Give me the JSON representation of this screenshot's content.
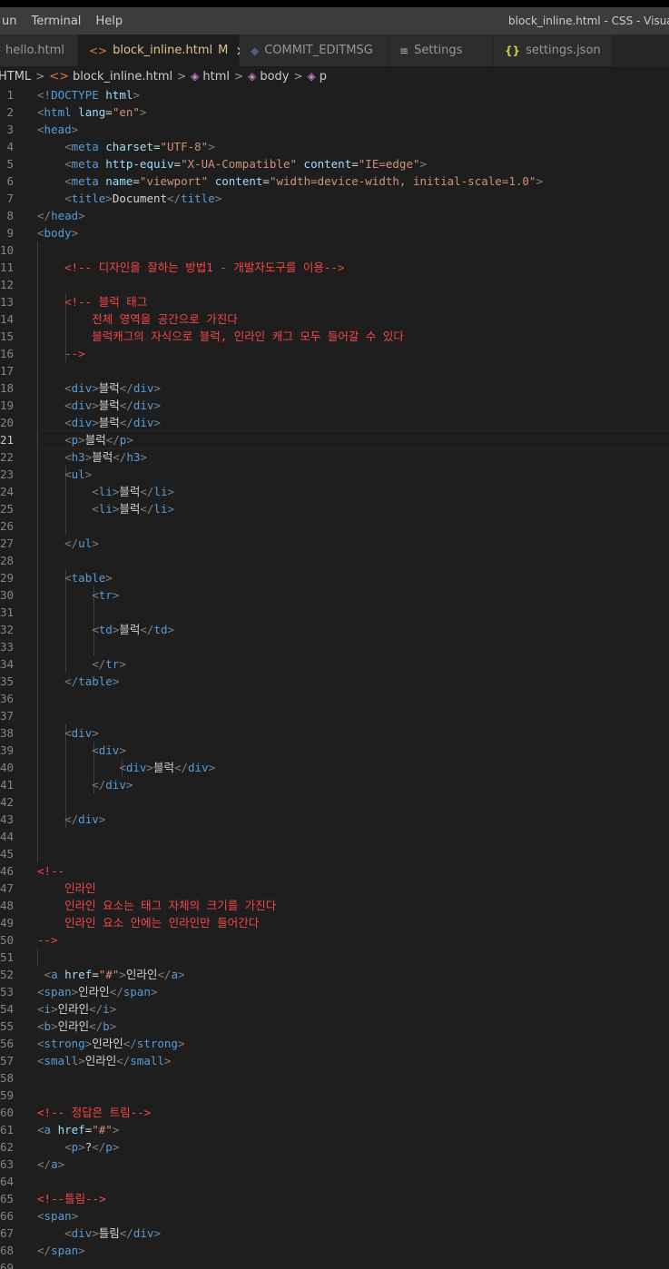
{
  "window": {
    "menu": [
      "un",
      "Terminal",
      "Help"
    ],
    "title": "block_inline.html - CSS - Visual"
  },
  "tabs": [
    {
      "label": "hello.html",
      "icon": "",
      "active": false
    },
    {
      "label": "block_inline.html",
      "icon": "html-file-icon",
      "active": true,
      "modified": "M",
      "close": "×"
    },
    {
      "label": "COMMIT_EDITMSG",
      "icon": "git-file-icon",
      "active": false
    },
    {
      "label": "Settings",
      "icon": "settings-icon",
      "active": false
    },
    {
      "label": "settings.json",
      "icon": "json-file-icon",
      "active": false
    }
  ],
  "breadcrumb": [
    "HTML",
    "block_inline.html",
    "html",
    "body",
    "p"
  ],
  "editor": {
    "current_line": 21,
    "lines": [
      [
        [
          "br",
          "<!"
        ],
        [
          "tag",
          "DOCTYPE "
        ],
        [
          "attr",
          "html"
        ],
        [
          "br",
          ">"
        ]
      ],
      [
        [
          "br",
          "<"
        ],
        [
          "tag",
          "html "
        ],
        [
          "attr",
          "lang"
        ],
        [
          "txt",
          "="
        ],
        [
          "str",
          "\"en\""
        ],
        [
          "br",
          ">"
        ]
      ],
      [
        [
          "br",
          "<"
        ],
        [
          "tag",
          "head"
        ],
        [
          "br",
          ">"
        ]
      ],
      [
        [
          "txt",
          "    "
        ],
        [
          "br",
          "<"
        ],
        [
          "tag",
          "meta "
        ],
        [
          "attr",
          "charset"
        ],
        [
          "txt",
          "="
        ],
        [
          "str",
          "\"UTF-8\""
        ],
        [
          "br",
          ">"
        ]
      ],
      [
        [
          "txt",
          "    "
        ],
        [
          "br",
          "<"
        ],
        [
          "tag",
          "meta "
        ],
        [
          "attr",
          "http-equiv"
        ],
        [
          "txt",
          "="
        ],
        [
          "str",
          "\"X-UA-Compatible\""
        ],
        [
          "txt",
          " "
        ],
        [
          "attr",
          "content"
        ],
        [
          "txt",
          "="
        ],
        [
          "str",
          "\"IE=edge\""
        ],
        [
          "br",
          ">"
        ]
      ],
      [
        [
          "txt",
          "    "
        ],
        [
          "br",
          "<"
        ],
        [
          "tag",
          "meta "
        ],
        [
          "attr",
          "name"
        ],
        [
          "txt",
          "="
        ],
        [
          "str",
          "\"viewport\""
        ],
        [
          "txt",
          " "
        ],
        [
          "attr",
          "content"
        ],
        [
          "txt",
          "="
        ],
        [
          "str",
          "\"width=device-width, initial-scale=1.0\""
        ],
        [
          "br",
          ">"
        ]
      ],
      [
        [
          "txt",
          "    "
        ],
        [
          "br",
          "<"
        ],
        [
          "tag",
          "title"
        ],
        [
          "br",
          ">"
        ],
        [
          "txt",
          "Document"
        ],
        [
          "br",
          "</"
        ],
        [
          "tag",
          "title"
        ],
        [
          "br",
          ">"
        ]
      ],
      [
        [
          "br",
          "</"
        ],
        [
          "tag",
          "head"
        ],
        [
          "br",
          ">"
        ]
      ],
      [
        [
          "br",
          "<"
        ],
        [
          "tag",
          "body"
        ],
        [
          "br",
          ">"
        ]
      ],
      [],
      [
        [
          "txt",
          "    "
        ],
        [
          "cm",
          "<!-- 디자인을 잘하는 방법1 - 개발자도구를 이용-->"
        ]
      ],
      [],
      [
        [
          "txt",
          "    "
        ],
        [
          "cm",
          "<!-- 블럭 태그"
        ]
      ],
      [
        [
          "cm",
          "        전체 영역을 공간으로 가진다"
        ]
      ],
      [
        [
          "cm",
          "        블럭캐그의 자식으로 블럭, 인라인 캐그 모두 들어갈 수 있다"
        ]
      ],
      [
        [
          "cm",
          "    -->"
        ]
      ],
      [],
      [
        [
          "txt",
          "    "
        ],
        [
          "br",
          "<"
        ],
        [
          "tag",
          "div"
        ],
        [
          "br",
          ">"
        ],
        [
          "txt",
          "블럭"
        ],
        [
          "br",
          "</"
        ],
        [
          "tag",
          "div"
        ],
        [
          "br",
          ">"
        ]
      ],
      [
        [
          "txt",
          "    "
        ],
        [
          "br",
          "<"
        ],
        [
          "tag",
          "div"
        ],
        [
          "br",
          ">"
        ],
        [
          "txt",
          "블럭"
        ],
        [
          "br",
          "</"
        ],
        [
          "tag",
          "div"
        ],
        [
          "br",
          ">"
        ]
      ],
      [
        [
          "txt",
          "    "
        ],
        [
          "br",
          "<"
        ],
        [
          "tag",
          "div"
        ],
        [
          "br",
          ">"
        ],
        [
          "txt",
          "블럭"
        ],
        [
          "br",
          "</"
        ],
        [
          "tag",
          "div"
        ],
        [
          "br",
          ">"
        ]
      ],
      [
        [
          "txt",
          "    "
        ],
        [
          "br",
          "<"
        ],
        [
          "tag",
          "p"
        ],
        [
          "br",
          ">"
        ],
        [
          "txt",
          "블럭"
        ],
        [
          "br",
          "</"
        ],
        [
          "tag",
          "p"
        ],
        [
          "br",
          ">"
        ]
      ],
      [
        [
          "txt",
          "    "
        ],
        [
          "br",
          "<"
        ],
        [
          "tag",
          "h3"
        ],
        [
          "br",
          ">"
        ],
        [
          "txt",
          "블럭"
        ],
        [
          "br",
          "</"
        ],
        [
          "tag",
          "h3"
        ],
        [
          "br",
          ">"
        ]
      ],
      [
        [
          "txt",
          "    "
        ],
        [
          "br",
          "<"
        ],
        [
          "tag",
          "ul"
        ],
        [
          "br",
          ">"
        ]
      ],
      [
        [
          "txt",
          "        "
        ],
        [
          "br",
          "<"
        ],
        [
          "tag",
          "li"
        ],
        [
          "br",
          ">"
        ],
        [
          "txt",
          "블럭"
        ],
        [
          "br",
          "</"
        ],
        [
          "tag",
          "li"
        ],
        [
          "br",
          ">"
        ]
      ],
      [
        [
          "txt",
          "        "
        ],
        [
          "br",
          "<"
        ],
        [
          "tag",
          "li"
        ],
        [
          "br",
          ">"
        ],
        [
          "txt",
          "블럭"
        ],
        [
          "br",
          "</"
        ],
        [
          "tag",
          "li"
        ],
        [
          "br",
          ">"
        ]
      ],
      [],
      [
        [
          "txt",
          "    "
        ],
        [
          "br",
          "</"
        ],
        [
          "tag",
          "ul"
        ],
        [
          "br",
          ">"
        ]
      ],
      [],
      [
        [
          "txt",
          "    "
        ],
        [
          "br",
          "<"
        ],
        [
          "tag",
          "table"
        ],
        [
          "br",
          ">"
        ]
      ],
      [
        [
          "txt",
          "        "
        ],
        [
          "br",
          "<"
        ],
        [
          "tag",
          "tr"
        ],
        [
          "br",
          ">"
        ]
      ],
      [],
      [
        [
          "txt",
          "        "
        ],
        [
          "br",
          "<"
        ],
        [
          "tag",
          "td"
        ],
        [
          "br",
          ">"
        ],
        [
          "txt",
          "블럭"
        ],
        [
          "br",
          "</"
        ],
        [
          "tag",
          "td"
        ],
        [
          "br",
          ">"
        ]
      ],
      [],
      [
        [
          "txt",
          "        "
        ],
        [
          "br",
          "</"
        ],
        [
          "tag",
          "tr"
        ],
        [
          "br",
          ">"
        ]
      ],
      [
        [
          "txt",
          "    "
        ],
        [
          "br",
          "</"
        ],
        [
          "tag",
          "table"
        ],
        [
          "br",
          ">"
        ]
      ],
      [],
      [],
      [
        [
          "txt",
          "    "
        ],
        [
          "br",
          "<"
        ],
        [
          "tag",
          "div"
        ],
        [
          "br",
          ">"
        ]
      ],
      [
        [
          "txt",
          "        "
        ],
        [
          "br",
          "<"
        ],
        [
          "tag",
          "div"
        ],
        [
          "br",
          ">"
        ]
      ],
      [
        [
          "txt",
          "            "
        ],
        [
          "br",
          "<"
        ],
        [
          "tag",
          "div"
        ],
        [
          "br",
          ">"
        ],
        [
          "txt",
          "블럭"
        ],
        [
          "br",
          "</"
        ],
        [
          "tag",
          "div"
        ],
        [
          "br",
          ">"
        ]
      ],
      [
        [
          "txt",
          "        "
        ],
        [
          "br",
          "</"
        ],
        [
          "tag",
          "div"
        ],
        [
          "br",
          ">"
        ]
      ],
      [],
      [
        [
          "txt",
          "    "
        ],
        [
          "br",
          "</"
        ],
        [
          "tag",
          "div"
        ],
        [
          "br",
          ">"
        ]
      ],
      [],
      [],
      [
        [
          "cm",
          "<!--"
        ]
      ],
      [
        [
          "cm",
          "    인라인"
        ]
      ],
      [
        [
          "cm",
          "    인라인 요소는 태그 자체의 크기를 가진다"
        ]
      ],
      [
        [
          "cm",
          "    인라인 요소 안에는 인라인만 들어간다"
        ]
      ],
      [
        [
          "cm",
          "-->"
        ]
      ],
      [],
      [
        [
          "txt",
          " "
        ],
        [
          "br",
          "<"
        ],
        [
          "tag",
          "a "
        ],
        [
          "attr",
          "href"
        ],
        [
          "txt",
          "="
        ],
        [
          "str",
          "\"#\""
        ],
        [
          "br",
          ">"
        ],
        [
          "txt",
          "인라인"
        ],
        [
          "br",
          "</"
        ],
        [
          "tag",
          "a"
        ],
        [
          "br",
          ">"
        ]
      ],
      [
        [
          "br",
          "<"
        ],
        [
          "tag",
          "span"
        ],
        [
          "br",
          ">"
        ],
        [
          "txt",
          "인라인"
        ],
        [
          "br",
          "</"
        ],
        [
          "tag",
          "span"
        ],
        [
          "br",
          ">"
        ]
      ],
      [
        [
          "br",
          "<"
        ],
        [
          "tag",
          "i"
        ],
        [
          "br",
          ">"
        ],
        [
          "txt",
          "인라인"
        ],
        [
          "br",
          "</"
        ],
        [
          "tag",
          "i"
        ],
        [
          "br",
          ">"
        ]
      ],
      [
        [
          "br",
          "<"
        ],
        [
          "tag",
          "b"
        ],
        [
          "br",
          ">"
        ],
        [
          "txt",
          "인라인"
        ],
        [
          "br",
          "</"
        ],
        [
          "tag",
          "b"
        ],
        [
          "br",
          ">"
        ]
      ],
      [
        [
          "br",
          "<"
        ],
        [
          "tag",
          "strong"
        ],
        [
          "br",
          ">"
        ],
        [
          "txt",
          "인라인"
        ],
        [
          "br",
          "</"
        ],
        [
          "tag",
          "strong"
        ],
        [
          "br",
          ">"
        ]
      ],
      [
        [
          "br",
          "<"
        ],
        [
          "tag",
          "small"
        ],
        [
          "br",
          ">"
        ],
        [
          "txt",
          "인라인"
        ],
        [
          "br",
          "</"
        ],
        [
          "tag",
          "small"
        ],
        [
          "br",
          ">"
        ]
      ],
      [],
      [],
      [
        [
          "cm",
          "<!-- 정답은 트림-->"
        ]
      ],
      [
        [
          "br",
          "<"
        ],
        [
          "tag",
          "a "
        ],
        [
          "attr",
          "href"
        ],
        [
          "txt",
          "="
        ],
        [
          "str",
          "\"#\""
        ],
        [
          "br",
          ">"
        ]
      ],
      [
        [
          "txt",
          "    "
        ],
        [
          "br",
          "<"
        ],
        [
          "tag",
          "p"
        ],
        [
          "br",
          ">"
        ],
        [
          "txt",
          "?"
        ],
        [
          "br",
          "</"
        ],
        [
          "tag",
          "p"
        ],
        [
          "br",
          ">"
        ]
      ],
      [
        [
          "br",
          "</"
        ],
        [
          "tag",
          "a"
        ],
        [
          "br",
          ">"
        ]
      ],
      [],
      [
        [
          "cm",
          "<!--틀림-->"
        ]
      ],
      [
        [
          "br",
          "<"
        ],
        [
          "tag",
          "span"
        ],
        [
          "br",
          ">"
        ]
      ],
      [
        [
          "txt",
          "    "
        ],
        [
          "br",
          "<"
        ],
        [
          "tag",
          "div"
        ],
        [
          "br",
          ">"
        ],
        [
          "txt",
          "틀림"
        ],
        [
          "br",
          "</"
        ],
        [
          "tag",
          "div"
        ],
        [
          "br",
          ">"
        ]
      ],
      [
        [
          "br",
          "</"
        ],
        [
          "tag",
          "span"
        ],
        [
          "br",
          ">"
        ]
      ],
      []
    ]
  },
  "colors": {
    "tag": "#569cd6",
    "bracket": "#808080",
    "attribute": "#9cdcfe",
    "string": "#ce9178",
    "comment": "#f44747",
    "text": "#d4d4d4",
    "active_tab_text": "#e2c08d"
  }
}
